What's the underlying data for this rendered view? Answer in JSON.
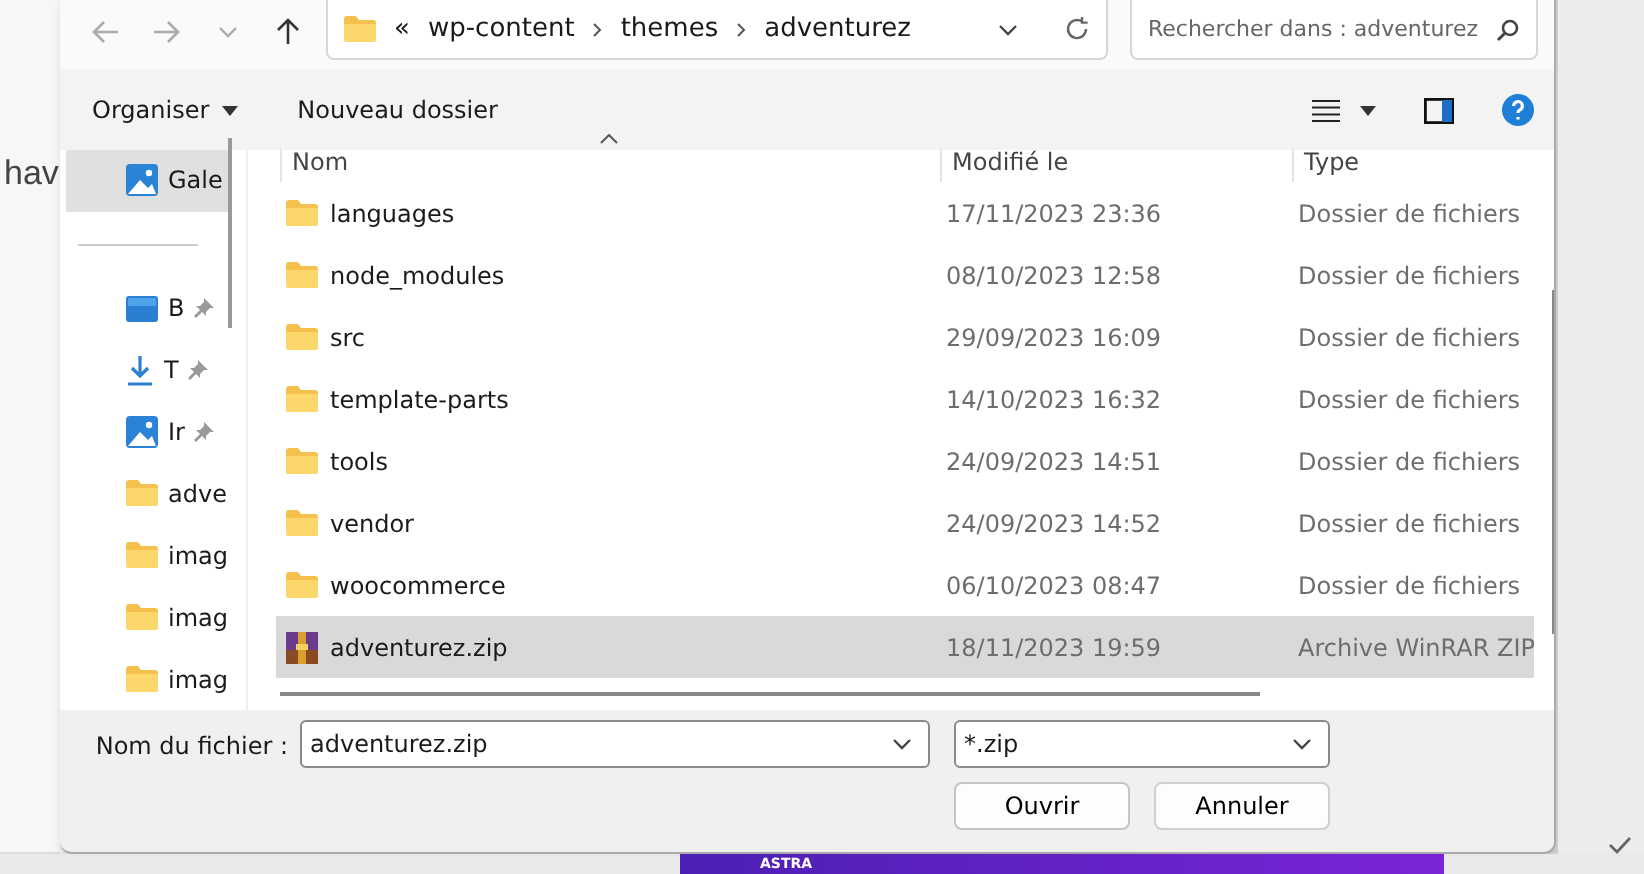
{
  "background": {
    "text": "hav",
    "banner": "ASTRA"
  },
  "address": {
    "overflow": "«",
    "crumbs": [
      "wp-content",
      "themes",
      "adventurez"
    ]
  },
  "search": {
    "placeholder": "Rechercher dans : adventurez"
  },
  "toolbar": {
    "organise": "Organiser",
    "new_folder": "Nouveau dossier"
  },
  "sidebar": {
    "items": [
      {
        "label": "Gale",
        "kind": "gallery",
        "pinned": false,
        "selected": true
      },
      {
        "label": "B",
        "kind": "desktop",
        "pinned": true,
        "selected": false
      },
      {
        "label": "T",
        "kind": "download",
        "pinned": true,
        "selected": false
      },
      {
        "label": "Ir",
        "kind": "pictures",
        "pinned": true,
        "selected": false
      },
      {
        "label": "adve",
        "kind": "folder",
        "pinned": false,
        "selected": false
      },
      {
        "label": "imag",
        "kind": "folder",
        "pinned": false,
        "selected": false
      },
      {
        "label": "imag",
        "kind": "folder",
        "pinned": false,
        "selected": false
      },
      {
        "label": "imag",
        "kind": "folder",
        "pinned": false,
        "selected": false
      }
    ]
  },
  "table": {
    "columns": [
      "Nom",
      "Modifié le",
      "Type"
    ],
    "rows": [
      {
        "name": "languages",
        "modified": "17/11/2023 23:36",
        "type": "Dossier de fichiers",
        "kind": "folder",
        "selected": false
      },
      {
        "name": "node_modules",
        "modified": "08/10/2023 12:58",
        "type": "Dossier de fichiers",
        "kind": "folder",
        "selected": false
      },
      {
        "name": "src",
        "modified": "29/09/2023 16:09",
        "type": "Dossier de fichiers",
        "kind": "folder",
        "selected": false
      },
      {
        "name": "template-parts",
        "modified": "14/10/2023 16:32",
        "type": "Dossier de fichiers",
        "kind": "folder",
        "selected": false
      },
      {
        "name": "tools",
        "modified": "24/09/2023 14:51",
        "type": "Dossier de fichiers",
        "kind": "folder",
        "selected": false
      },
      {
        "name": "vendor",
        "modified": "24/09/2023 14:52",
        "type": "Dossier de fichiers",
        "kind": "folder",
        "selected": false
      },
      {
        "name": "woocommerce",
        "modified": "06/10/2023 08:47",
        "type": "Dossier de fichiers",
        "kind": "folder",
        "selected": false
      },
      {
        "name": "adventurez.zip",
        "modified": "18/11/2023 19:59",
        "type": "Archive WinRAR ZIP",
        "kind": "archive",
        "selected": true
      }
    ]
  },
  "filename": {
    "label": "Nom du fichier :",
    "value": "adventurez.zip"
  },
  "filter": {
    "value": "*.zip"
  },
  "buttons": [
    "Ouvrir",
    "Annuler"
  ]
}
